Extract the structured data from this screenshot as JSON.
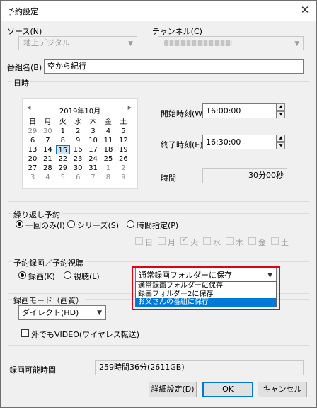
{
  "window": {
    "title": "予約設定",
    "close_glyph": "✕"
  },
  "source": {
    "label": "ソース(N)",
    "value": "地上デジタル"
  },
  "channel": {
    "label": "チャンネル(C)"
  },
  "program": {
    "label": "番組名(B)",
    "value": "空から紀行"
  },
  "datetime": {
    "group_title": "日時",
    "calendar": {
      "month_label": "2019年10月",
      "prev": "◀",
      "next": "▶",
      "weekdays": [
        "日",
        "月",
        "火",
        "水",
        "木",
        "金",
        "土"
      ],
      "weeks": [
        [
          "29",
          "30",
          "1",
          "2",
          "3",
          "4",
          "5"
        ],
        [
          "6",
          "7",
          "8",
          "9",
          "10",
          "11",
          "12"
        ],
        [
          "13",
          "14",
          "15",
          "16",
          "17",
          "18",
          "19"
        ],
        [
          "20",
          "21",
          "22",
          "23",
          "24",
          "25",
          "26"
        ],
        [
          "27",
          "28",
          "29",
          "30",
          "31",
          "1",
          "2"
        ],
        [
          "3",
          "4",
          "5",
          "6",
          "7",
          "8",
          "9"
        ]
      ],
      "today": "15"
    },
    "start_label": "開始時刻(W)",
    "start_value": "16:00:00",
    "end_label": "終了時刻(E)",
    "end_value": "16:30:00",
    "duration_label": "時間",
    "duration_value": "30分00秒",
    "spin_up": "▲",
    "spin_down": "▼"
  },
  "repeat": {
    "group_title": "繰り返し予約",
    "once": "一回のみ(I)",
    "series": "シリーズ(S)",
    "time_spec": "時間指定(P)",
    "days": [
      "日",
      "月",
      "火",
      "水",
      "木",
      "金",
      "土"
    ]
  },
  "record": {
    "group_title": "予約録画／予約視聴",
    "record_label": "録画(K)",
    "watch_label": "視聴(L)",
    "folder_value": "通常録画フォルダーに保存",
    "folder_options": [
      "通常録画フォルダーに保存",
      "録画フォルダー2に保存",
      "お父さんの番組に保存"
    ]
  },
  "mode": {
    "group_title": "録画モード（画質）",
    "value": "ダイレクト(HD)",
    "outdoor_label": "外でもVIDEO(ワイヤレス転送)"
  },
  "available": {
    "label": "録画可能時間",
    "value": "259時間36分(2611GB)"
  },
  "buttons": {
    "detail": "詳細設定(D)",
    "ok": "OK",
    "cancel": "キャンセル"
  }
}
